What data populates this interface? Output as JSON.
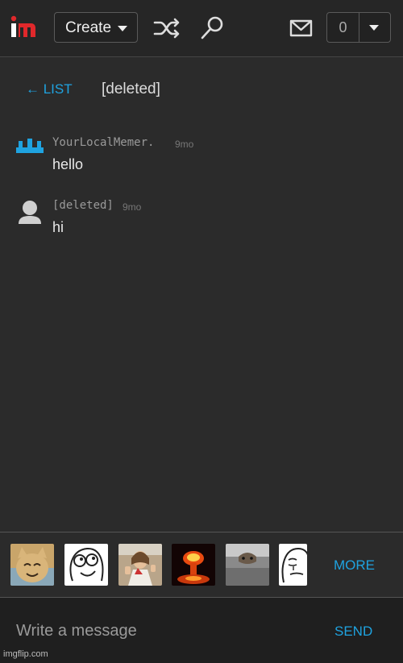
{
  "nav": {
    "create_label": "Create",
    "notif_count": "0",
    "accent_red": "#e0282b",
    "accent_blue": "#1fa3e0",
    "icons": [
      "imgflip-logo-icon",
      "shuffle-icon",
      "search-icon",
      "mail-icon",
      "chevron-down-icon"
    ]
  },
  "conversation": {
    "back_label": "← LIST",
    "title": "[deleted]"
  },
  "messages": [
    {
      "author": "YourLocalMemer.",
      "time": "9mo",
      "text": "hello"
    },
    {
      "author": "[deleted]",
      "time": "9mo",
      "text": "hi"
    }
  ],
  "meme_strip": {
    "items": [
      "cat-meme-thumb",
      "derp-face-thumb",
      "buddy-christ-thumb",
      "nuke-explosion-thumb",
      "ceiling-cat-thumb",
      "okay-face-thumb"
    ],
    "more_label": "MORE"
  },
  "composer": {
    "placeholder": "Write a message",
    "send_label": "SEND"
  },
  "watermark": "imgflip.com"
}
